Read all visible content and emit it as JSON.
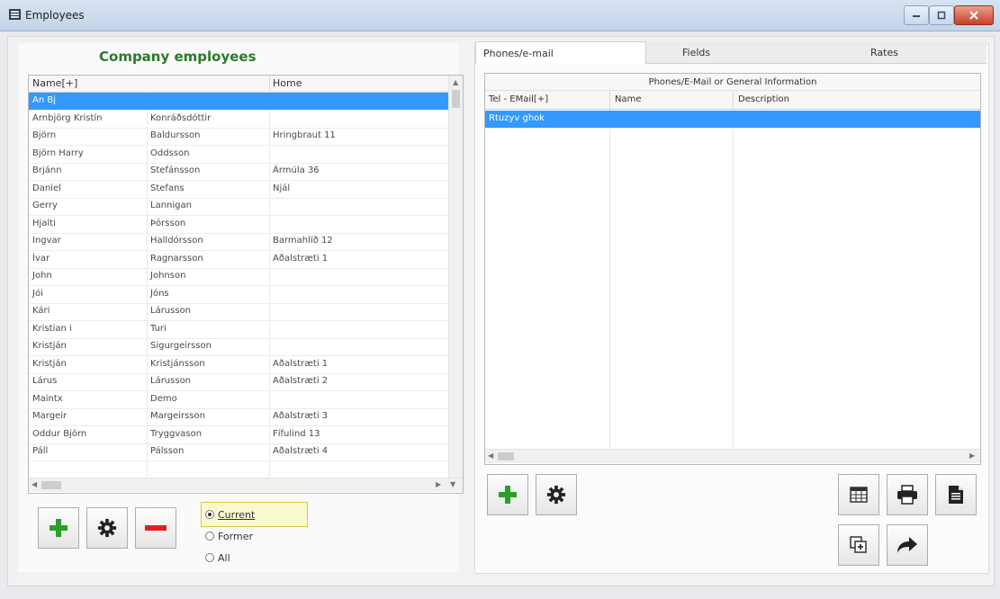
{
  "window": {
    "title": "Employees"
  },
  "employees": {
    "heading": "Company employees",
    "columns": [
      "Name[+]",
      "",
      "Home"
    ],
    "rows": [
      [
        "An Bj",
        "",
        ""
      ],
      [
        "Arnbjörg Kristín",
        "Konráðsdóttir",
        ""
      ],
      [
        "Björn",
        "Baldursson",
        "Hringbraut 11"
      ],
      [
        "Björn Harry",
        "Oddsson",
        ""
      ],
      [
        "Brjánn",
        "Stefánsson",
        "Ármúla 36"
      ],
      [
        "Daniel",
        "Stefans",
        "Njál"
      ],
      [
        "Gerry",
        "Lannigan",
        ""
      ],
      [
        "Hjalti",
        "Þórsson",
        ""
      ],
      [
        "Ingvar",
        "Halldórsson",
        "Barmahlíð 12"
      ],
      [
        "Ívar",
        "Ragnarsson",
        "Aðalstræti 1"
      ],
      [
        "John",
        "Johnson",
        ""
      ],
      [
        "Jói",
        "Jóns",
        ""
      ],
      [
        "Kári",
        "Lárusson",
        ""
      ],
      [
        "Kristian i",
        "Turi",
        ""
      ],
      [
        "Kristján",
        "Sigurgeirsson",
        ""
      ],
      [
        "Kristján",
        "Kristjánsson",
        "Aðalstræti 1"
      ],
      [
        "Lárus",
        "Lárusson",
        "Aðalstræti 2"
      ],
      [
        "Maintx",
        "Demo",
        ""
      ],
      [
        "Margeir",
        "Margeirsson",
        "Aðalstræti 3"
      ],
      [
        "Oddur Björn",
        "Tryggvason",
        "Fífulind 13"
      ],
      [
        "Páll",
        "Pálsson",
        "Aðalstræti 4"
      ],
      [
        "",
        "",
        ""
      ]
    ],
    "selected_index": 0
  },
  "status_filter": {
    "options": [
      "Current",
      "Former",
      "All"
    ],
    "selected": "Current"
  },
  "tabs": [
    "Phones/e-mail",
    "Fields",
    "Rates"
  ],
  "active_tab": 0,
  "phones": {
    "caption": "Phones/E-Mail or General Information",
    "columns": [
      "Tel - EMail[+]",
      "Name",
      "Description"
    ],
    "rows": [
      [
        "Rtuzyv ghok",
        "",
        ""
      ]
    ],
    "selected_index": 0
  },
  "colors": {
    "selection": "#3399ff",
    "heading_green": "#2b7a2b",
    "add_green": "#2aa02a",
    "remove_red": "#e02020"
  },
  "icons": [
    "add-icon",
    "gear-icon",
    "remove-icon",
    "table-icon",
    "printer-icon",
    "document-icon",
    "copy-add-icon",
    "forward-arrow-icon"
  ]
}
